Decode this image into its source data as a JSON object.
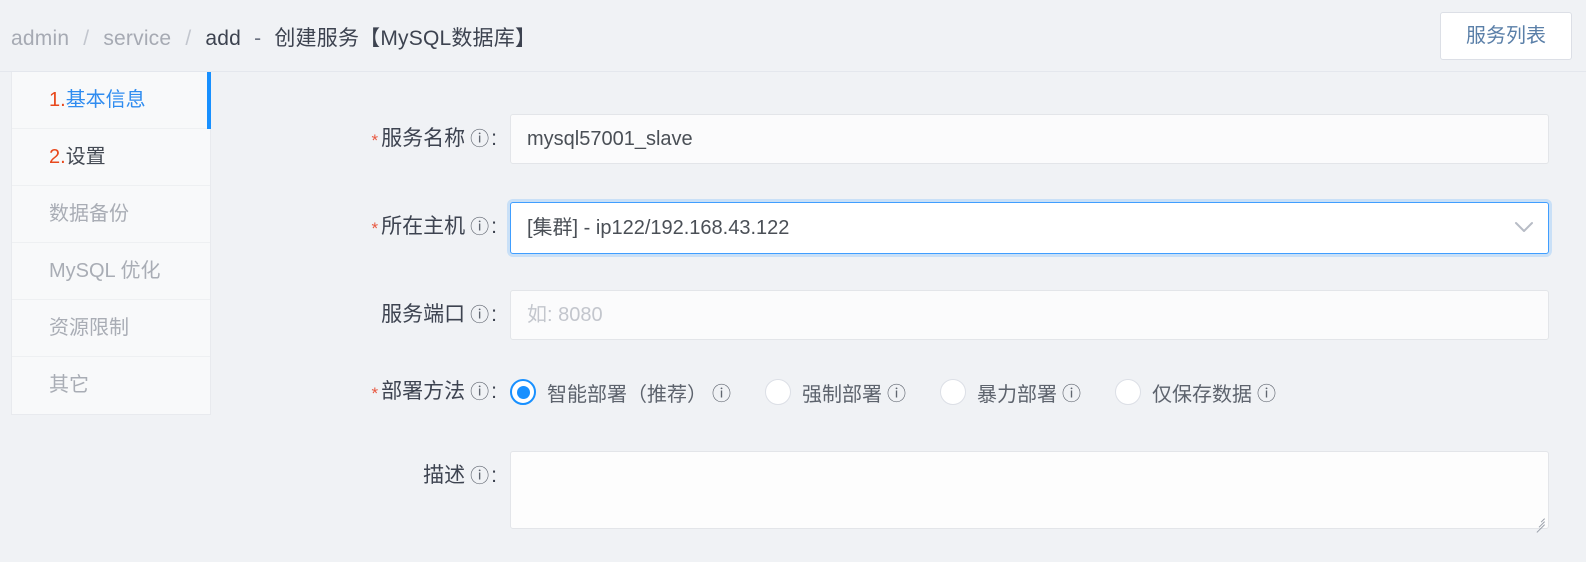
{
  "header": {
    "breadcrumb": {
      "root": "admin",
      "sep1": "/",
      "section": "service",
      "sep2": "/",
      "page": "add",
      "dash": "-",
      "title": "创建服务【MySQL数据库】"
    },
    "service_list_button": "服务列表"
  },
  "sidebar": {
    "items": [
      {
        "num": "1.",
        "label": "基本信息",
        "state": "active"
      },
      {
        "num": "2.",
        "label": "设置",
        "state": "step"
      },
      {
        "num": "",
        "label": "数据备份",
        "state": "disabled"
      },
      {
        "num": "",
        "label": "MySQL 优化",
        "state": "disabled"
      },
      {
        "num": "",
        "label": "资源限制",
        "state": "disabled"
      },
      {
        "num": "",
        "label": "其它",
        "state": "disabled"
      }
    ]
  },
  "form": {
    "required_mark": "*",
    "help_icon": "?",
    "colon": ":",
    "chevron_down_icon": "⌄",
    "service_name": {
      "label": "服务名称",
      "value": "mysql57001_slave",
      "placeholder": ""
    },
    "host": {
      "label": "所在主机",
      "value": "[集群] - ip122/192.168.43.122"
    },
    "port": {
      "label": "服务端口",
      "value": "",
      "placeholder": "如: 8080"
    },
    "deploy_method": {
      "label": "部署方法",
      "options": [
        {
          "label": "智能部署（推荐）",
          "selected": true,
          "help": "?"
        },
        {
          "label": "强制部署",
          "selected": false,
          "help": "?"
        },
        {
          "label": "暴力部署",
          "selected": false,
          "help": "?"
        },
        {
          "label": "仅保存数据",
          "selected": false,
          "help": "?"
        }
      ]
    },
    "description": {
      "label": "描述",
      "value": "",
      "placeholder": ""
    }
  },
  "colors": {
    "accent": "#1890ff",
    "required": "#e8573f",
    "step_number": "#e8491d",
    "background": "#f0f2f5"
  }
}
